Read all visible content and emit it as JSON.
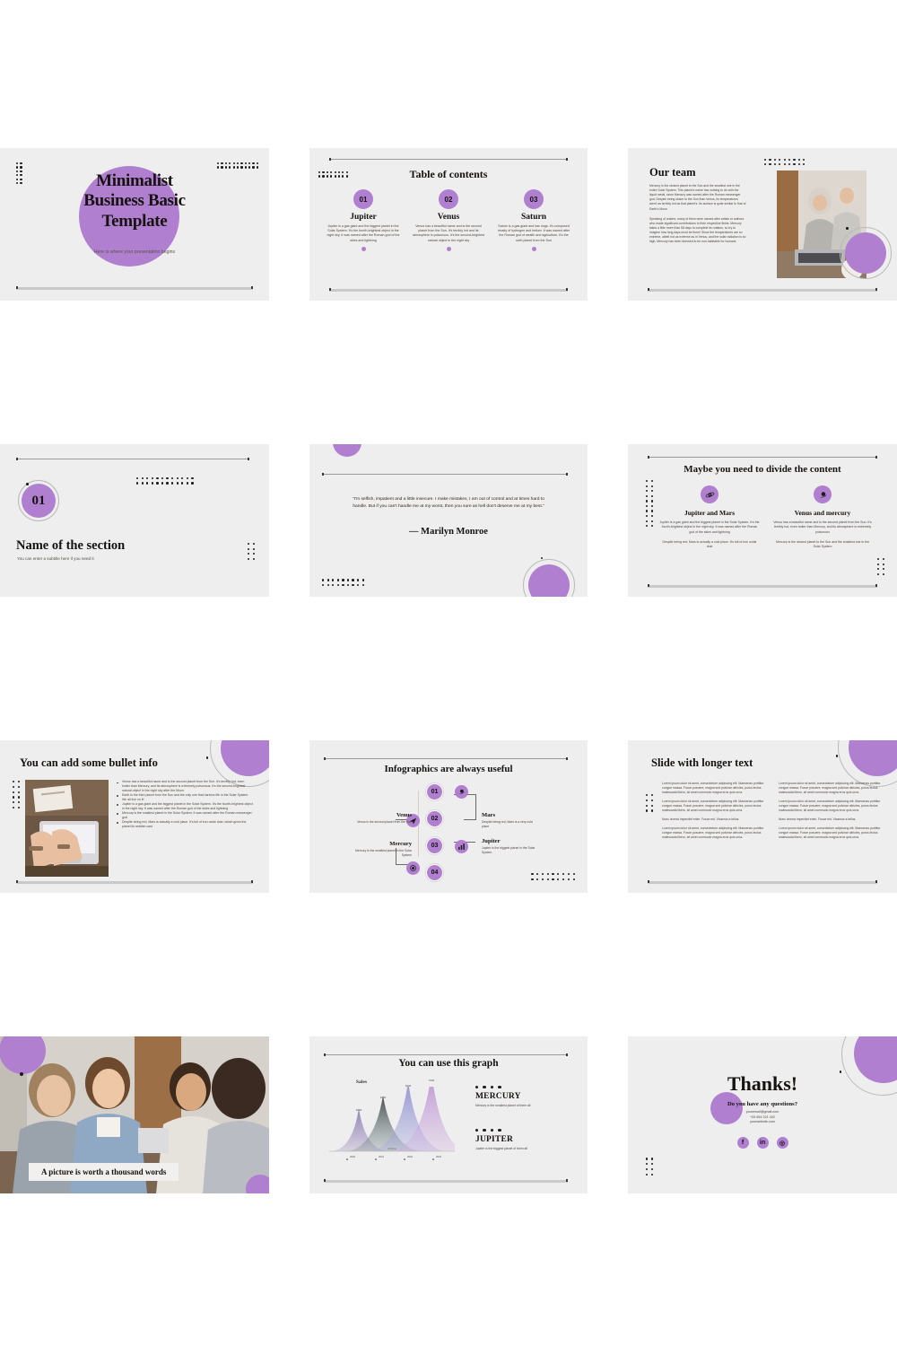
{
  "theme": {
    "accent": "#b07fd0",
    "slide_bg": "#eeeeee",
    "page_bg": "#ffffff",
    "ink": "#15120f"
  },
  "slides": {
    "title": {
      "title_line1": "Minimalist",
      "title_line2": "Business Basic",
      "title_line3": "Template",
      "subtitle": "Here is where your presentation begins"
    },
    "toc": {
      "title": "Table of contents",
      "items": [
        {
          "num": "01",
          "name": "Jupiter",
          "body": "Jupiter is a gas giant and the biggest planet in the Solar System. It's the fourth-brightest object in the night sky. It was named after the Roman god of the skies and lightning"
        },
        {
          "num": "02",
          "name": "Venus",
          "body": "Venus has a beautiful name and is the second planet from the Sun. It's terribly hot and its atmosphere is poisonous. It's the second-brightest natural object in the night sky"
        },
        {
          "num": "03",
          "name": "Saturn",
          "body": "Saturn is a gas giant and has rings. It's composed mostly of hydrogen and helium. It was named after the Roman god of wealth and agriculture. It's the sixth planet from the Sun"
        }
      ]
    },
    "team": {
      "title": "Our team",
      "para1": "Mercury is the closest planet to the Sun and the smallest one in the entire Solar System. This planet's name has nothing to do with the liquid metal, since Mercury was named after the Roman messenger god. Despite being closer to the Sun than Venus, its temperatures aren't as terribly hot as that planet's. Its surface is quite similar to that of Earth's Moon",
      "para2": "Speaking of craters, many of them were named after artists or authors who made significant contributions to their respective fields. Mercury takes a little more than 58 days to complete its rotation, so try to imagine how long days must be there! Since the temperatures are so extreme, albeit not as extreme as in Venus, and the solar radiation is so high, Mercury has been deemed to be non-habitable for humans",
      "photo_alt": "two-women-at-laptop-photo"
    },
    "section": {
      "number": "01",
      "title": "Name of the section",
      "subtitle": "You can enter a subtitle here if you need it"
    },
    "quote": {
      "text": "“I'm selfish, impatient and a little insecure. I make mistakes, I am out of control and at times hard to handle. But if you can't handle me at my worst, then you sure as hell don't deserve me at my best.”",
      "author": "— Marilyn Monroe"
    },
    "divide": {
      "title": "Maybe you need to divide the content",
      "columns": [
        {
          "icon": "planet-eye-icon",
          "heading": "Jupiter and Mars",
          "para1": "Jupiter is a gas giant and the biggest planet in the Solar System. It's the fourth-brightest object in the night sky. It was named after the Roman god of the skies and lightning",
          "para2": "Despite being red, Mars is actually a cold place. It's full of iron oxide dust"
        },
        {
          "icon": "saturn-icon",
          "heading": "Venus and mercury",
          "para1": "Venus has a beautiful name and is the second planet from the Sun. It's terribly hot, even hotter than Mercury, and its atmosphere is extremely poisonous",
          "para2": "Mercury is the closest planet to the Sun and the smallest one in the Solar System"
        }
      ]
    },
    "bullets": {
      "title": "You can add some bullet info",
      "photo_alt": "hands-typing-on-laptop-photo",
      "items": [
        "Venus has a beautiful name and is the second planet from the Sun. It's terribly hot, even hotter than Mercury, and its atmosphere is extremely poisonous. It's the second-brightest natural object in the night sky after the Moon",
        "Earth is the third planet from the Sun and the only one that harbors life in the Solar System. We all live on it!",
        "Jupiter is a gas giant and the biggest planet in the Solar System. It's the fourth-brightest object in the night sky. It was named after the Roman god of the skies and lightning",
        "Mercury is the smallest planet in the Solar System. It was named after the Roman messenger god",
        "Despite being red, Mars is actually a cold place. It's full of iron oxide dust, which gives the planet its reddish cast"
      ]
    },
    "infographics": {
      "title": "Infographics are always useful",
      "nodes": [
        {
          "num": "01",
          "icon": "saturn-icon"
        },
        {
          "num": "02",
          "icon": "rocket-icon"
        },
        {
          "num": "03",
          "icon": "bar-chart-icon"
        },
        {
          "num": "04",
          "icon": "target-icon"
        }
      ],
      "left": [
        {
          "heading": "Venus",
          "body": "Venus is the second planet from the Sun"
        },
        {
          "heading": "Mercury",
          "body": "Mercury is the smallest planet in the Solar System"
        }
      ],
      "right": [
        {
          "heading": "Mars",
          "body": "Despite being red, Mars is a very cold place"
        },
        {
          "heading": "Jupiter",
          "body": "Jupiter is the biggest planet in the Solar System"
        }
      ]
    },
    "longer_text": {
      "title": "Slide with longer text",
      "left": [
        "Lorem ipsum dolor sit amet, consectetuer adipiscing elit. Maecenas porttitor congue massa. Fusce posuere, magna sed pulvinar ultricies, purus lectus malesuada libero, sit amet commodo magna eros quis urna.",
        "Lorem ipsum dolor sit amet, consectetuer adipiscing elit. Maecenas porttitor congue massa. Fusce posuere, magna sed pulvinar ultricies, purus lectus malesuada libero, sit amet commodo magna eros quis urna.",
        "Nunc viverra imperdiet enim. Fusce est. Vivamus a tellus.",
        "Lorem ipsum dolor sit amet, consectetuer adipiscing elit. Maecenas porttitor congue massa. Fusce posuere, magna sed pulvinar ultricies, purus lectus malesuada libero, sit amet commodo magna eros quis urna."
      ],
      "right": [
        "Lorem ipsum dolor sit amet, consectetuer adipiscing elit. Maecenas porttitor congue massa. Fusce posuere, magna sed pulvinar ultricies, purus lectus malesuada libero, sit amet commodo magna eros quis urna.",
        "Lorem ipsum dolor sit amet, consectetuer adipiscing elit. Maecenas porttitor congue massa. Fusce posuere, magna sed pulvinar ultricies, purus lectus malesuada libero, sit amet commodo magna eros quis urna.",
        "Nunc viverra imperdiet enim. Fusce est. Vivamus a tellus.",
        "Lorem ipsum dolor sit amet, consectetuer adipiscing elit. Maecenas porttitor congue massa. Fusce posuere, magna sed pulvinar ultricies, purus lectus malesuada libero, sit amet commodo magna eros quis urna."
      ]
    },
    "picture": {
      "caption": "A picture is worth a thousand words",
      "photo_alt": "four-students-smiling-around-laptop-photo"
    },
    "graph": {
      "title": "You can use this graph",
      "keys": [
        {
          "heading": "MERCURY",
          "body": "Mercury is the smallest planet of them all"
        },
        {
          "heading": "JUPITER",
          "body": "Jupiter is the biggest planet of them all"
        }
      ]
    },
    "thanks": {
      "title": "Thanks!",
      "question": "Do you have any questions?",
      "email": "youremail@gmail.com",
      "phone": "+34 654 321 432",
      "website": "yourwebsite.com",
      "social": [
        {
          "name": "facebook-icon",
          "glyph": "f"
        },
        {
          "name": "linkedin-icon",
          "glyph": "in"
        },
        {
          "name": "instagram-icon",
          "glyph": "◎"
        }
      ]
    }
  },
  "chart_data": {
    "type": "area",
    "title": "Sales",
    "xlabel": "products",
    "ylabel": "",
    "categories": [
      "2020",
      "2021",
      "2022",
      "2023"
    ],
    "values": [
      2000,
      4000,
      6000,
      7000
    ],
    "series": [
      {
        "name": "2020",
        "values": [
          2000
        ],
        "color": "#8f7fb5"
      },
      {
        "name": "2021",
        "values": [
          4000
        ],
        "color": "#56605e"
      },
      {
        "name": "2022",
        "values": [
          6000
        ],
        "color": "#8d8fd0"
      },
      {
        "name": "2023",
        "values": [
          7000
        ],
        "color": "#b98fd0"
      }
    ],
    "ylim": [
      0,
      7500
    ],
    "grid": false,
    "legend": "none"
  }
}
